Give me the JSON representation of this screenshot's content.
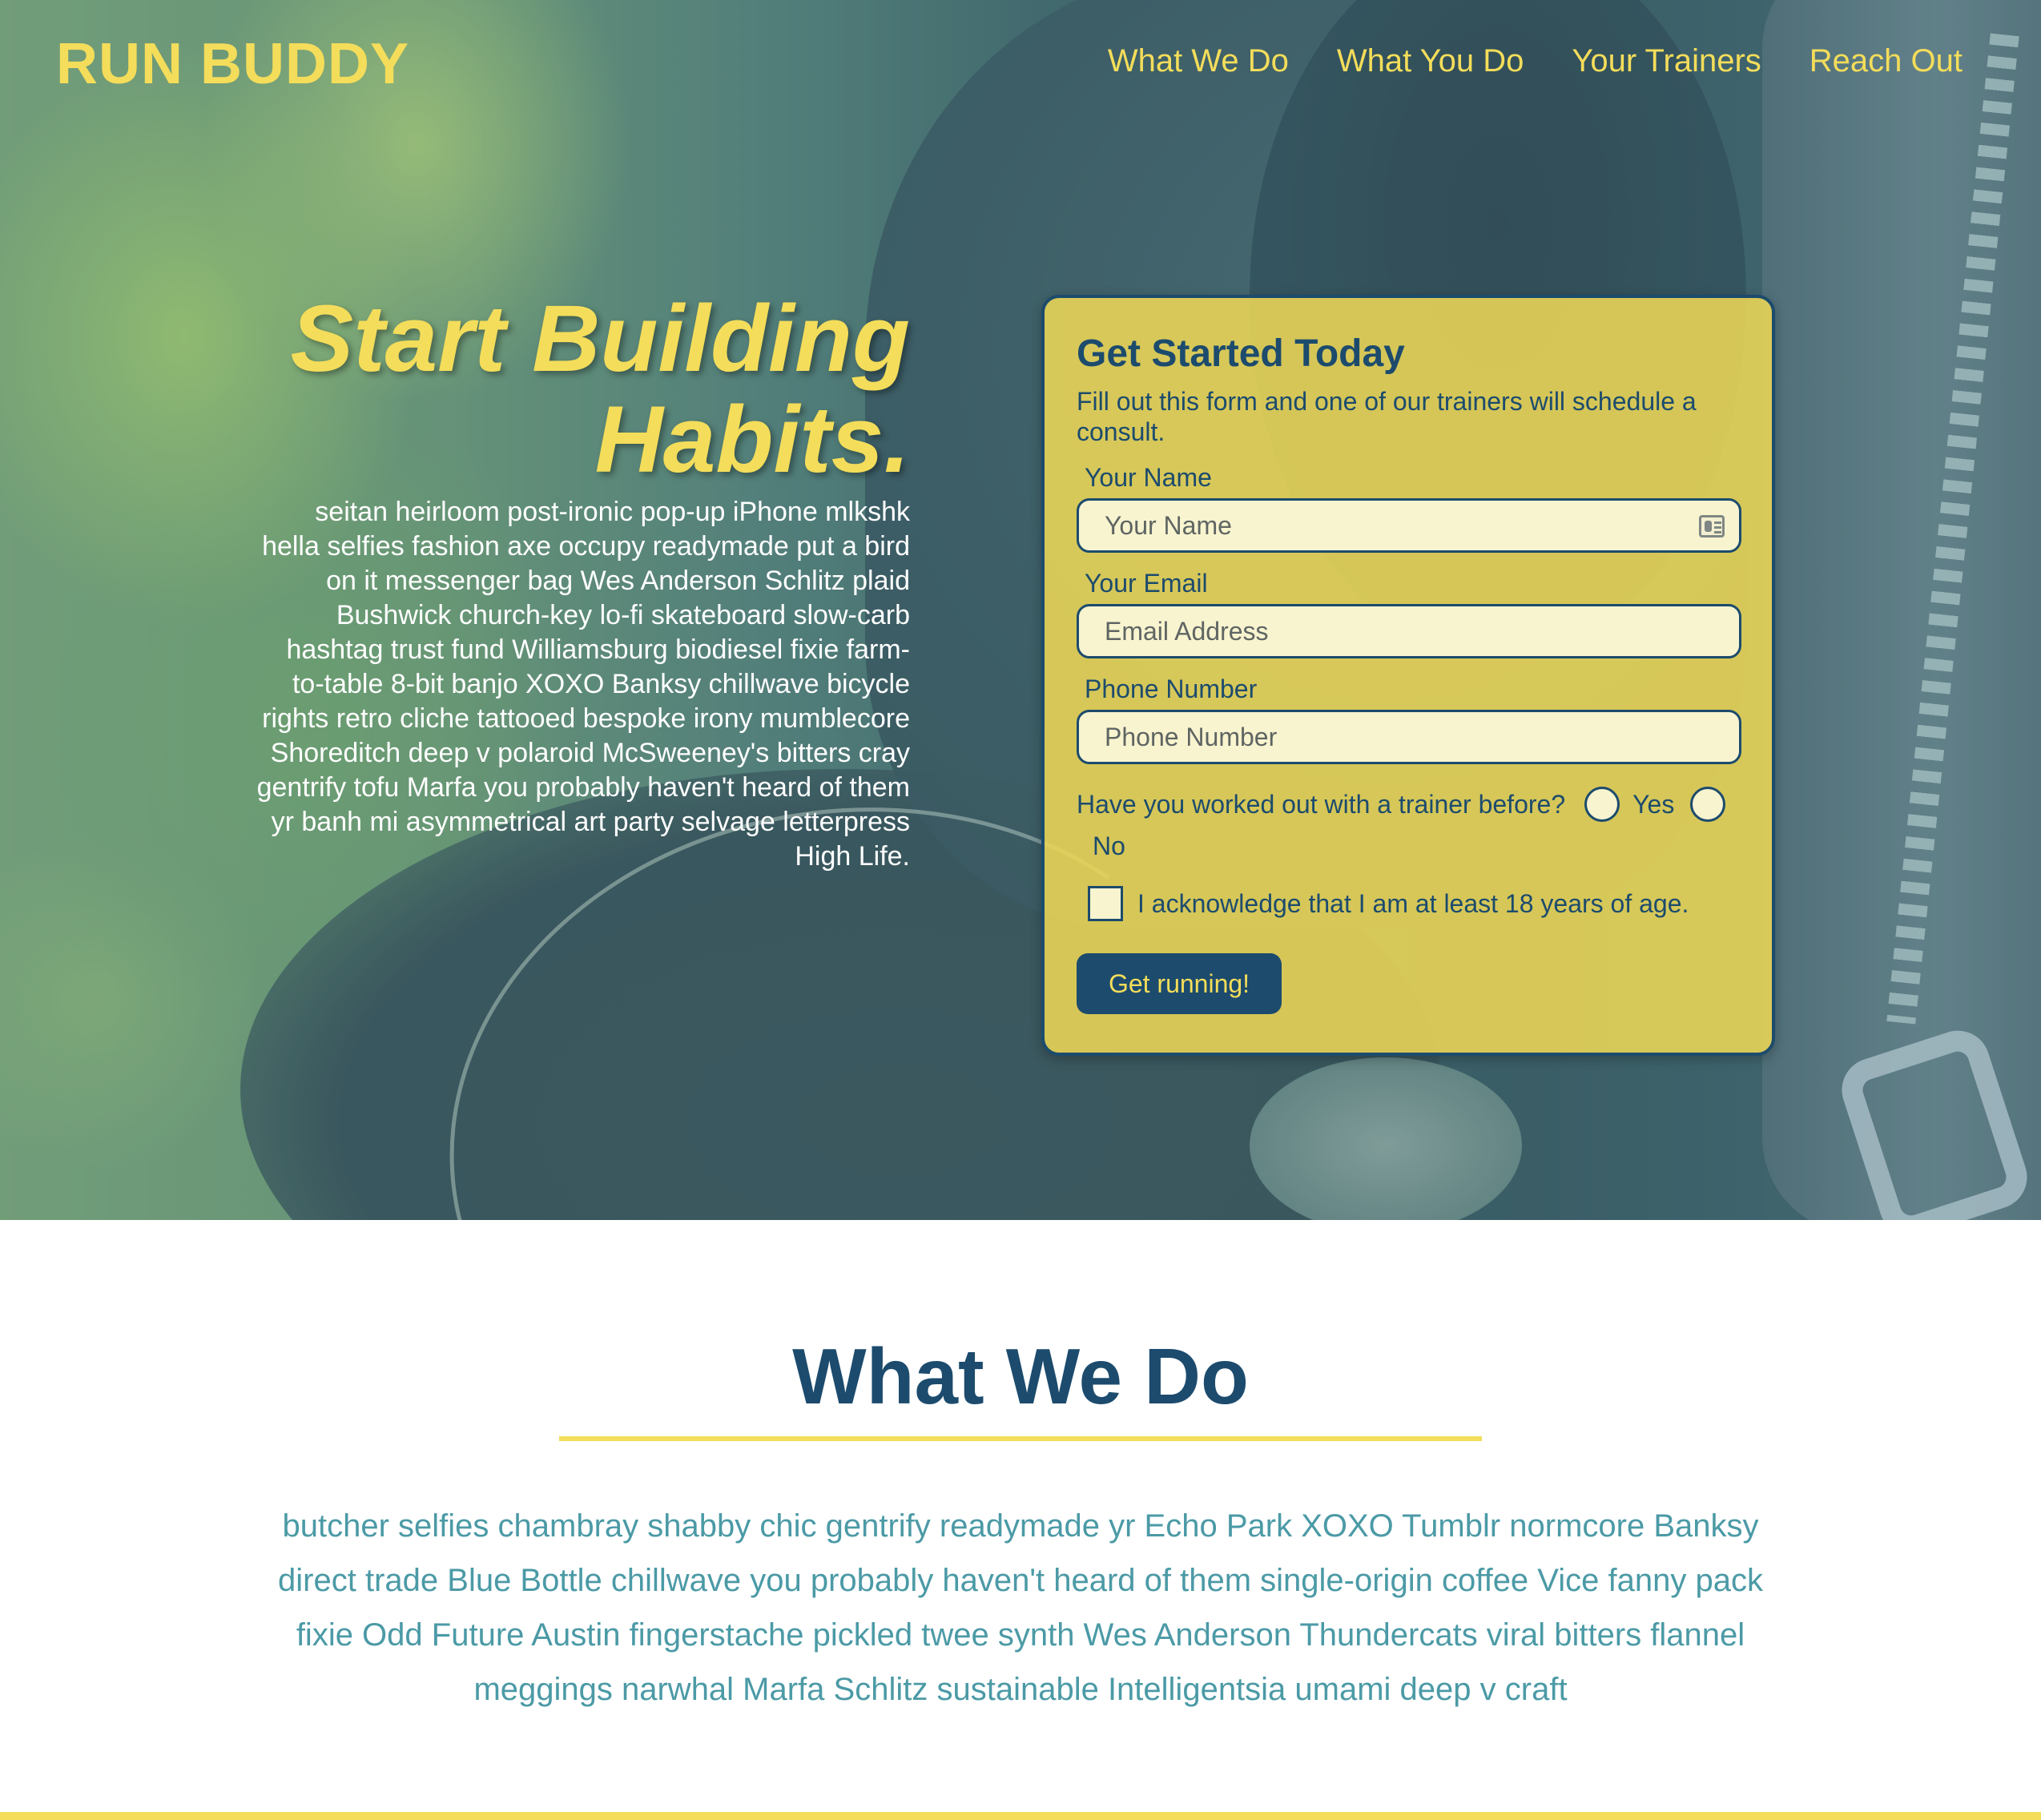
{
  "header": {
    "logo": "RUN BUDDY",
    "nav": [
      "What We Do",
      "What You Do",
      "Your Trainers",
      "Reach Out"
    ]
  },
  "hero": {
    "title": "Start Building Habits.",
    "body": "seitan heirloom post-ironic pop-up iPhone mlkshk hella selfies fashion axe occupy readymade put a bird on it messenger bag Wes Anderson Schlitz plaid Bushwick church-key lo-fi skateboard slow-carb hashtag trust fund Williamsburg biodiesel fixie farm-to-table 8-bit banjo XOXO Banksy chillwave bicycle rights retro cliche tattooed bespoke irony mumblecore Shoreditch deep v polaroid McSweeney's bitters cray gentrify tofu Marfa you probably haven't heard of them yr banh mi asymmetrical art party selvage letterpress High Life."
  },
  "form": {
    "title": "Get Started Today",
    "subtitle": "Fill out this form and one of our trainers will schedule a consult.",
    "name_label": "Your Name",
    "name_placeholder": "Your Name",
    "email_label": "Your Email",
    "email_placeholder": "Email Address",
    "phone_label": "Phone Number",
    "phone_placeholder": "Phone Number",
    "trainer_question": "Have you worked out with a trainer before?",
    "option_yes": "Yes",
    "option_no": "No",
    "acknowledge": "I acknowledge that I am at least 18 years of age.",
    "submit": "Get running!",
    "icons": {
      "name_field": "contact-card-icon"
    }
  },
  "what_we_do": {
    "title": "What We Do",
    "body": "butcher selfies chambray shabby chic gentrify readymade yr Echo Park XOXO Tumblr normcore Banksy direct trade Blue Bottle chillwave you probably haven't heard of them single-origin coffee Vice fanny pack fixie Odd Future Austin fingerstache pickled twee synth Wes Anderson Thundercats viral bitters flannel meggings narwhal Marfa Schlitz sustainable Intelligentsia umami deep v craft"
  },
  "colors": {
    "accent_yellow": "#f4dd5a",
    "primary_blue": "#1c4b6d",
    "teal_text": "#4b9aa6",
    "form_background": "#ecd656"
  }
}
